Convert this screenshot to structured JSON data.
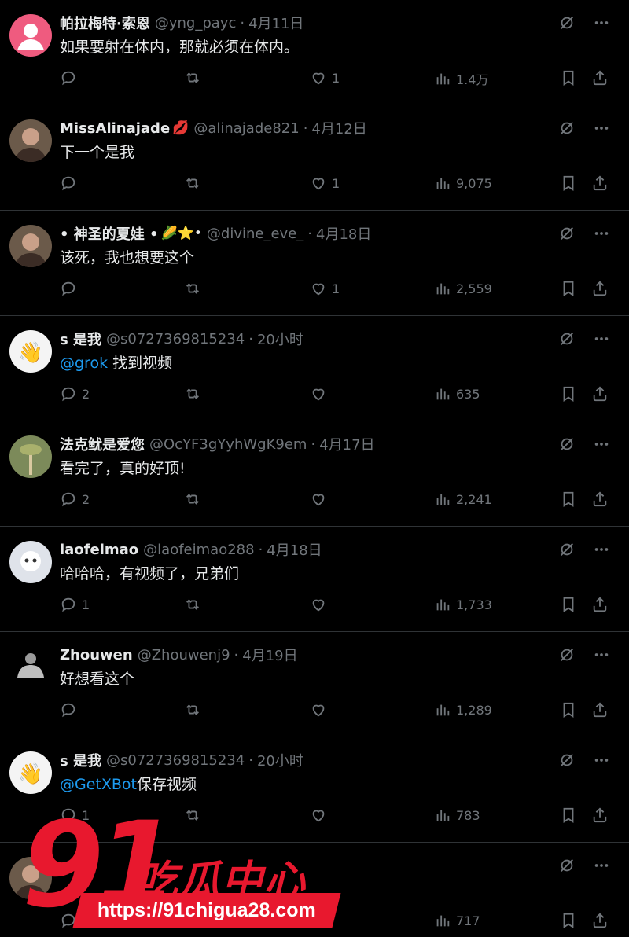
{
  "replies": [
    {
      "name": "帕拉梅特·索恩",
      "handle": "@yng_payc",
      "time": "4月11日",
      "emoji": "",
      "text_mention": "",
      "text": "如果要射在体内，那就必须在体内。",
      "replies": "",
      "likes": "1",
      "views": "1.4万",
      "avatar": "default-avatar"
    },
    {
      "name": "MissAlinajade",
      "handle": "@alinajade821",
      "time": "4月12日",
      "emoji": "💋",
      "text_mention": "",
      "text": "下一个是我",
      "replies": "",
      "likes": "1",
      "views": "9,075",
      "avatar": "photo-avatar"
    },
    {
      "name": "• 神圣的夏娃 •",
      "handle": "@divine_eve_",
      "time": "4月18日",
      "emoji": "🌽⭐•",
      "text_mention": "",
      "text": "该死，我也想要这个",
      "replies": "",
      "likes": "1",
      "views": "2,559",
      "avatar": "photo-avatar"
    },
    {
      "name": "s 是我",
      "handle": "@s0727369815234",
      "time": "20小时",
      "emoji": "",
      "text_mention": "@grok",
      "text": " 找到视频",
      "replies": "2",
      "likes": "",
      "views": "635",
      "avatar": "wave-hand-avatar"
    },
    {
      "name": "法克鱿是爱您",
      "handle": "@OcYF3gYyhWgK9em",
      "time": "4月17日",
      "emoji": "",
      "text_mention": "",
      "text": "看完了，真的好顶!",
      "replies": "2",
      "likes": "",
      "views": "2,241",
      "avatar": "plant-avatar"
    },
    {
      "name": "laofeimao",
      "handle": "@laofeimao288",
      "time": "4月18日",
      "emoji": "",
      "text_mention": "",
      "text": "哈哈哈，有视频了，兄弟们",
      "replies": "1",
      "likes": "",
      "views": "1,733",
      "avatar": "robot-avatar"
    },
    {
      "name": "Zhouwen",
      "handle": "@Zhouwenj9",
      "time": "4月19日",
      "emoji": "",
      "text_mention": "",
      "text": "好想看这个",
      "replies": "",
      "likes": "",
      "views": "1,289",
      "avatar": "muscle-avatar"
    },
    {
      "name": "s 是我",
      "handle": "@s0727369815234",
      "time": "20小时",
      "emoji": "",
      "text_mention": "@GetXBot",
      "text": "保存视频",
      "replies": "1",
      "likes": "",
      "views": "783",
      "avatar": "wave-hand-avatar"
    },
    {
      "name": "",
      "handle": "",
      "time": "",
      "emoji": "",
      "text_mention": "",
      "text": "",
      "replies": "",
      "likes": "",
      "views": "717",
      "avatar": "photo-avatar"
    }
  ],
  "watermark": {
    "number": "91",
    "brand": "吃瓜中心",
    "url": "https://91chigua28.com"
  },
  "colors": {
    "background": "#000000",
    "text": "#e7e9ea",
    "muted": "#71767b",
    "mention": "#1d9bf0",
    "divider": "#2f3336",
    "watermark": "#e8182e"
  }
}
